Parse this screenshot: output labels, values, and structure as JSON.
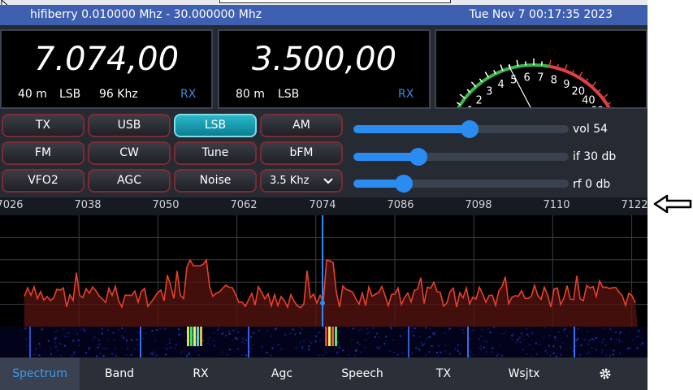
{
  "title": {
    "left": "hifiberry 0.010000 Mhz - 30.000000 Mhz",
    "right": "Tue Nov  7 00:17:35 2023"
  },
  "vfo1": {
    "freq": "7.074,00",
    "band": "40 m",
    "mode": "LSB",
    "bw": "96 Khz",
    "status": "RX"
  },
  "vfo2": {
    "freq": "3.500,00",
    "band": "80 m",
    "mode": "LSB",
    "status": "RX"
  },
  "meter": {
    "labels": [
      "1",
      "2",
      "3",
      "4",
      "5",
      "6",
      "7",
      "8",
      "9",
      "20",
      "40",
      "60"
    ],
    "needle_fraction": 0.33
  },
  "buttons": {
    "tx": "TX",
    "usb": "USB",
    "lsb": "LSB",
    "am": "AM",
    "fm": "FM",
    "cw": "CW",
    "tune": "Tune",
    "bfm": "bFM",
    "vfo2": "VFO2",
    "agc": "AGC",
    "noise": "Noise",
    "filter": "3.5 Khz"
  },
  "sliders": {
    "vol": {
      "label": "vol 54",
      "value": 54
    },
    "if": {
      "label": "if 30 db",
      "value": 30
    },
    "rf": {
      "label": "rf 0 db",
      "value": 0
    }
  },
  "scale": {
    "ticks": [
      "7026",
      "7038",
      "7050",
      "7062",
      "7074",
      "7086",
      "7098",
      "7110",
      "7122"
    ]
  },
  "tabs": [
    "Spectrum",
    "Band",
    "RX",
    "Agc",
    "Speech",
    "TX",
    "Wsjtx"
  ],
  "colors": {
    "accent": "#2a8cf0",
    "active_button": "#15a3b8",
    "title_bar": "#3f5fb0",
    "spectrum_line": "#e8402a"
  },
  "icons": {
    "settings": "gear-icon",
    "annotation": "left-arrow-icon"
  }
}
